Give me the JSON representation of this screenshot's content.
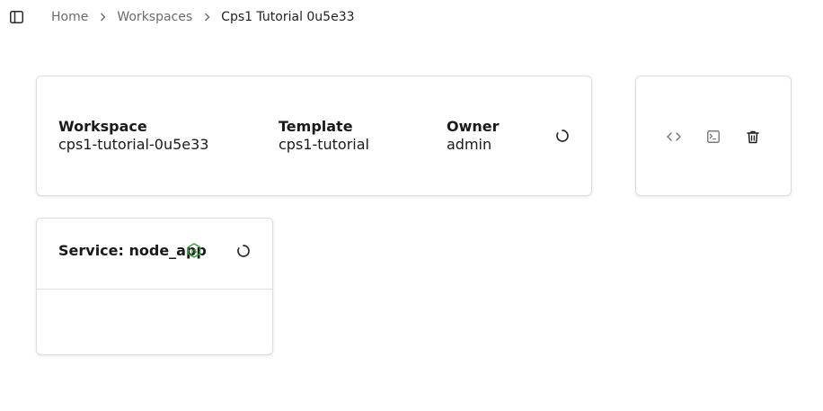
{
  "breadcrumb": {
    "items": [
      {
        "label": "Home"
      },
      {
        "label": "Workspaces"
      },
      {
        "label": "Cps1 Tutorial 0u5e33"
      }
    ]
  },
  "workspace_card": {
    "workspace": {
      "label": "Workspace",
      "value": "cps1-tutorial-0u5e33"
    },
    "template": {
      "label": "Template",
      "value": "cps1-tutorial"
    },
    "owner": {
      "label": "Owner",
      "value": "admin"
    },
    "status_icon": "loading-spinner-icon"
  },
  "actions_card": {
    "buttons": [
      {
        "icon": "code-icon"
      },
      {
        "icon": "terminal-icon"
      },
      {
        "icon": "trash-icon"
      }
    ]
  },
  "service_card": {
    "title": "Service: node_app",
    "icon": "nodejs-icon",
    "status_icon": "loading-spinner-icon"
  },
  "colors": {
    "nodejs_green": "#3c9d3c",
    "muted_text": "#6b6b6b",
    "border": "#dedede"
  }
}
